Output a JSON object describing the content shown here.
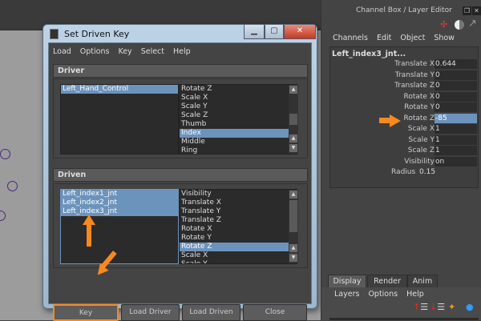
{
  "dialog": {
    "title": "Set Driven Key",
    "menu": [
      "Load",
      "Options",
      "Key",
      "Select",
      "Help"
    ],
    "driver": {
      "header": "Driver",
      "objects": [
        "Left_Hand_Control"
      ],
      "attributes": [
        "Rotate Z",
        "Scale X",
        "Scale Y",
        "Scale Z",
        "Thumb",
        "Index",
        "Middle",
        "Ring"
      ],
      "selected_attribute": "Index"
    },
    "driven": {
      "header": "Driven",
      "objects": [
        "Left_index1_jnt",
        "Left_index2_jnt",
        "Left_index3_jnt"
      ],
      "attributes": [
        "Visibility",
        "Translate X",
        "Translate Y",
        "Translate Z",
        "Rotate X",
        "Rotate Y",
        "Rotate Z",
        "Scale X",
        "Scale Y"
      ],
      "selected_attribute": "Rotate Z"
    },
    "buttons": {
      "key": "Key",
      "load_driver": "Load Driver",
      "load_driven": "Load Driven",
      "close": "Close"
    }
  },
  "channel_box": {
    "title": "Channel Box / Layer Editor",
    "menu": [
      "Channels",
      "Edit",
      "Object",
      "Show"
    ],
    "object": "Left_index3_jnt...",
    "channels": [
      {
        "name": "Translate X",
        "value": "0.644"
      },
      {
        "name": "Translate Y",
        "value": "0"
      },
      {
        "name": "Translate Z",
        "value": "0"
      },
      {
        "name": "Rotate X",
        "value": "0"
      },
      {
        "name": "Rotate Y",
        "value": "0"
      },
      {
        "name": "Rotate Z",
        "value": "-85"
      },
      {
        "name": "Scale X",
        "value": "1"
      },
      {
        "name": "Scale Y",
        "value": "1"
      },
      {
        "name": "Scale Z",
        "value": "1"
      },
      {
        "name": "Visibility",
        "value": "on"
      }
    ],
    "radius": {
      "name": "Radius",
      "value": "0.15"
    }
  },
  "layer_editor": {
    "tabs": [
      "Display",
      "Render",
      "Anim"
    ],
    "menu": [
      "Layers",
      "Options",
      "Help"
    ]
  },
  "colors": {
    "highlight": "#6c93bc",
    "annotation": "#f7891e"
  }
}
